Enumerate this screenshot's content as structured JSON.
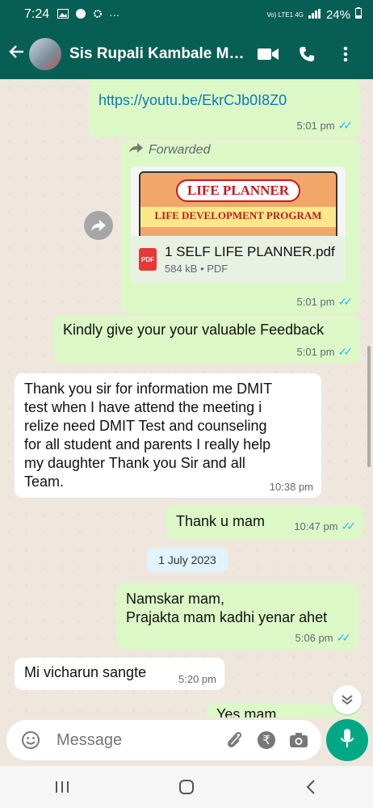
{
  "status_bar": {
    "time": "7:24",
    "more": "···",
    "network": "Vo) LTE1 4G",
    "battery": "24%"
  },
  "header": {
    "contact_name": "Sis Rupali Kambale Ma...",
    "back_icon": "arrow-left-icon",
    "video_icon": "video-call-icon",
    "call_icon": "phone-icon",
    "menu_icon": "kebab-menu-icon"
  },
  "messages": [
    {
      "type": "out",
      "text": "https://youtu.be/EkrCJb0I8Z0",
      "time": "5:01 pm"
    },
    {
      "type": "out",
      "forwarded_label": "Forwarded",
      "doc_thumb_title": "LIFE PLANNER",
      "doc_thumb_subtitle": "LIFE DEVELOPMENT PROGRAM",
      "doc_name": "1 SELF LIFE PLANNER.pdf",
      "doc_meta": "584 kB • PDF",
      "doc_icon_label": "PDF",
      "time": "5:01 pm"
    },
    {
      "type": "out",
      "text": "Kindly give your your valuable Feedback",
      "time": "5:01 pm"
    },
    {
      "type": "in",
      "lines": [
        "Thank you  sir for information me DMIT",
        "test when I have attend the meeting i",
        "relize need DMIT Test and counseling",
        "for all student and parents I really help",
        "my daughter Thank you Sir and all",
        "Team."
      ],
      "time": "10:38 pm"
    },
    {
      "type": "out",
      "text": "Thank u mam",
      "time": "10:47 pm"
    },
    {
      "type": "date",
      "text": "1 July 2023"
    },
    {
      "type": "out",
      "lines": [
        "Namskar mam,",
        "Prajakta mam kadhi yenar ahet"
      ],
      "time": "5:06 pm"
    },
    {
      "type": "in",
      "text": "Mi vicharun sangte",
      "time": "5:20 pm"
    },
    {
      "type": "out",
      "text": "Yes mam"
    }
  ],
  "input": {
    "placeholder": "Message"
  },
  "colors": {
    "header": "#075e54",
    "outgoing": "#dcf8c6",
    "incoming": "#ffffff",
    "mic": "#00a884",
    "ticks": "#34b7f1"
  }
}
